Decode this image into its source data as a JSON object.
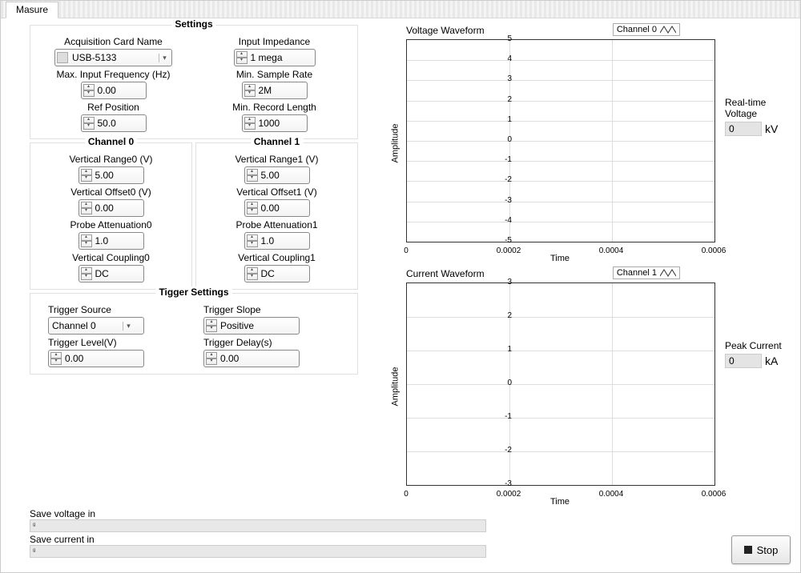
{
  "tab": {
    "label": "Masure"
  },
  "settings": {
    "title": "Settings",
    "acq_name_label": "Acquisition Card Name",
    "acq_name": "USB-5133",
    "impedance_label": "Input Impedance",
    "impedance": "1 mega",
    "max_freq_label": "Max. Input Frequency (Hz)",
    "max_freq": "0.00",
    "min_rate_label": "Min. Sample Rate",
    "min_rate": "2M",
    "ref_pos_label": "Ref Position",
    "ref_pos": "50.0",
    "min_rec_label": "Min. Record Length",
    "min_rec": "1000"
  },
  "ch0": {
    "title": "Channel 0",
    "range_label": "Vertical Range0 (V)",
    "range": "5.00",
    "offset_label": "Vertical Offset0 (V)",
    "offset": "0.00",
    "atten_label": "Probe Attenuation0",
    "atten": "1.0",
    "coupling_label": "Vertical Coupling0",
    "coupling": "DC"
  },
  "ch1": {
    "title": "Channel 1",
    "range_label": "Vertical Range1 (V)",
    "range": "5.00",
    "offset_label": "Vertical Offset1 (V)",
    "offset": "0.00",
    "atten_label": "Probe Attenuation1",
    "atten": "1.0",
    "coupling_label": "Vertical Coupling1",
    "coupling": "DC"
  },
  "trigger": {
    "title": "Tigger Settings",
    "source_label": "Trigger Source",
    "source": "Channel 0",
    "slope_label": "Trigger Slope",
    "slope": "Positive",
    "level_label": "Trigger Level(V)",
    "level": "0.00",
    "delay_label": "Trigger Delay(s)",
    "delay": "0.00"
  },
  "voltage_chart": {
    "title": "Voltage Waveform",
    "legend": "Channel 0",
    "ylabel": "Amplitude",
    "xlabel": "Time"
  },
  "current_chart": {
    "title": "Current Waveform",
    "legend": "Channel 1",
    "ylabel": "Amplitude",
    "xlabel": "Time"
  },
  "readouts": {
    "rtv_label": "Real-time Voltage",
    "rtv_val": "0",
    "rtv_unit": "kV",
    "pc_label": "Peak Current",
    "pc_val": "0",
    "pc_unit": "kA"
  },
  "save": {
    "voltage_label": "Save voltage in",
    "voltage_path": "ᵍ",
    "current_label": "Save current in",
    "current_path": "ᵍ"
  },
  "stop_label": "Stop",
  "chart_data": [
    {
      "type": "line",
      "title": "Voltage Waveform",
      "xlabel": "Time",
      "ylabel": "Amplitude",
      "x_ticks": [
        0,
        0.0002,
        0.0004,
        0.0006
      ],
      "y_ticks": [
        -5,
        -4,
        -3,
        -2,
        -1,
        0,
        1,
        2,
        3,
        4,
        5
      ],
      "xlim": [
        0,
        0.0006
      ],
      "ylim": [
        -5,
        5
      ],
      "series": [
        {
          "name": "Channel 0",
          "x": [],
          "y": []
        }
      ]
    },
    {
      "type": "line",
      "title": "Current Waveform",
      "xlabel": "Time",
      "ylabel": "Amplitude",
      "x_ticks": [
        0,
        0.0002,
        0.0004,
        0.0006
      ],
      "y_ticks": [
        -3,
        -2,
        -1,
        0,
        1,
        2,
        3
      ],
      "xlim": [
        0,
        0.0006
      ],
      "ylim": [
        -3,
        3
      ],
      "series": [
        {
          "name": "Channel 1",
          "x": [],
          "y": []
        }
      ]
    }
  ]
}
